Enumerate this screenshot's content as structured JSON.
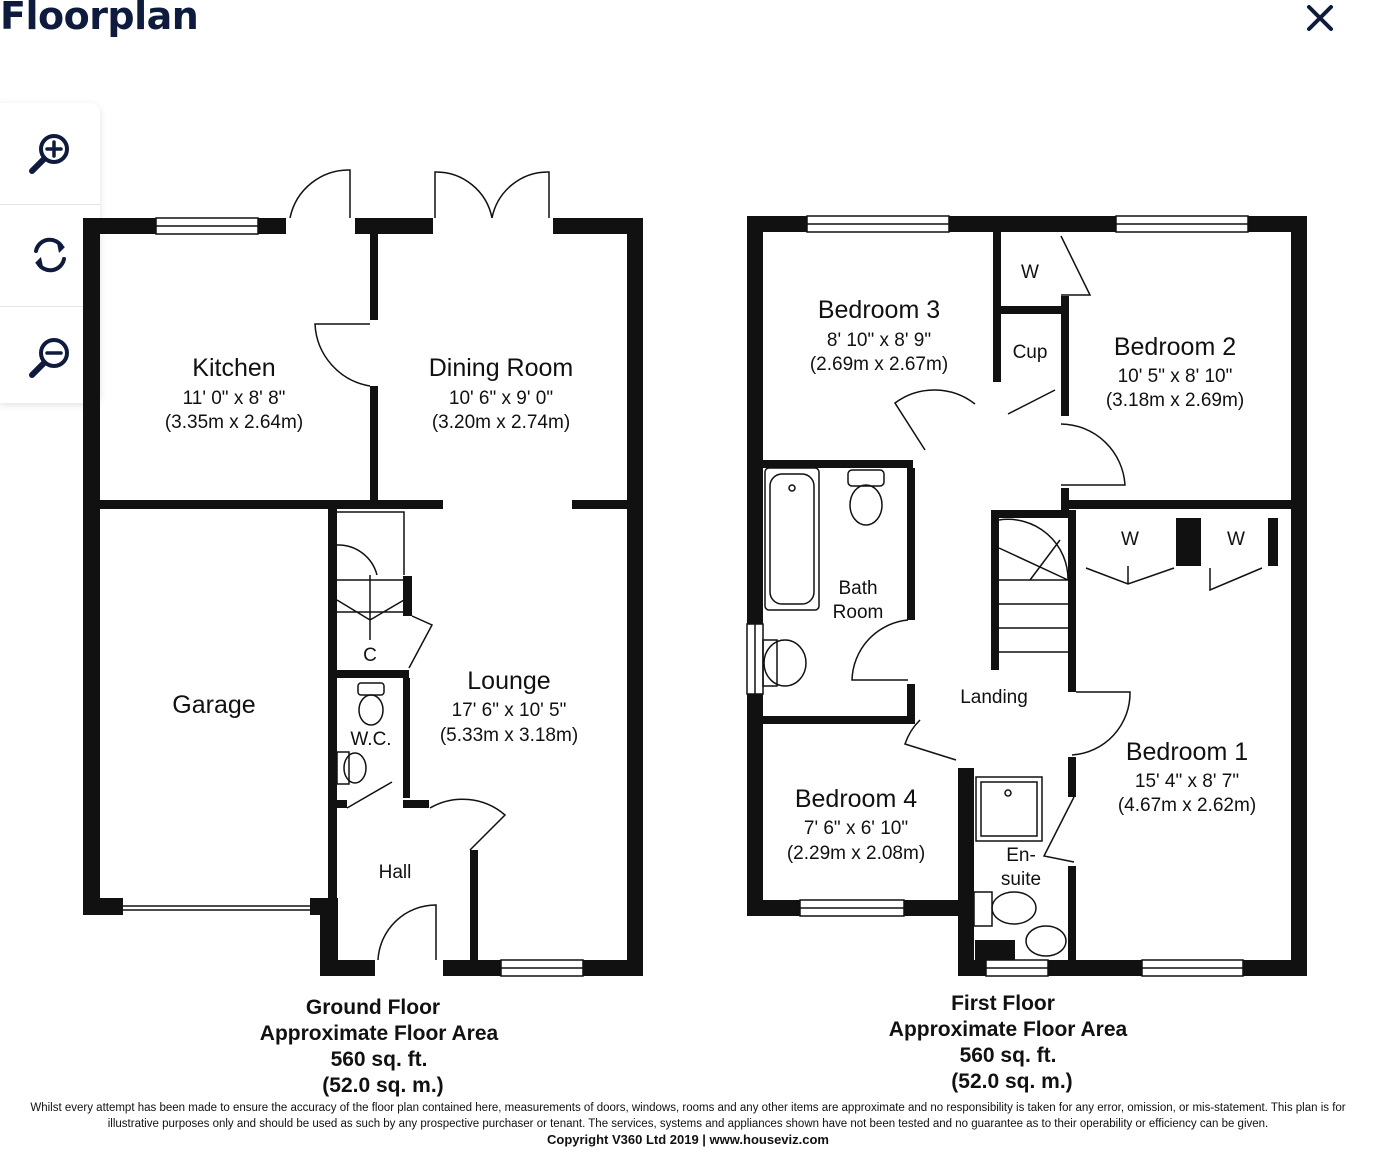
{
  "header": {
    "title": "Floorplan",
    "close_icon": "close-icon"
  },
  "zoom_controls": {
    "zoom_in_icon": "zoom-in-icon",
    "reset_icon": "reset-icon",
    "zoom_out_icon": "zoom-out-icon"
  },
  "colors": {
    "title": "#0f1b3d",
    "walls": "#111111",
    "icons": "#0f1b3d"
  },
  "ground_floor": {
    "rooms": {
      "kitchen": {
        "name": "Kitchen",
        "dim_imperial": "11' 0\" x 8' 8\"",
        "dim_metric": "(3.35m x 2.64m)"
      },
      "dining": {
        "name": "Dining Room",
        "dim_imperial": "10' 6\" x 9' 0\"",
        "dim_metric": "(3.20m x 2.74m)"
      },
      "garage": {
        "name": "Garage"
      },
      "lounge": {
        "name": "Lounge",
        "dim_imperial": "17' 6\" x 10' 5\"",
        "dim_metric": "(5.33m x 3.18m)"
      },
      "cupboard": {
        "name": "C"
      },
      "wc": {
        "name": "W.C."
      },
      "hall": {
        "name": "Hall"
      }
    },
    "label": {
      "line1": "Ground Floor",
      "line2": "Approximate Floor Area",
      "line3": "560 sq. ft.",
      "line4": "(52.0 sq. m.)"
    }
  },
  "first_floor": {
    "rooms": {
      "bedroom3": {
        "name": "Bedroom 3",
        "dim_imperial": "8' 10\" x 8' 9\"",
        "dim_metric": "(2.69m x 2.67m)"
      },
      "bedroom2": {
        "name": "Bedroom 2",
        "dim_imperial": "10' 5\" x 8' 10\"",
        "dim_metric": "(3.18m x 2.69m)"
      },
      "wardrobe_top": {
        "name": "W"
      },
      "cupboard": {
        "name": "Cup"
      },
      "bathroom": {
        "line1": "Bath",
        "line2": "Room"
      },
      "wardrobe_1": {
        "name": "W"
      },
      "wardrobe_2": {
        "name": "W"
      },
      "landing": {
        "name": "Landing"
      },
      "bedroom1": {
        "name": "Bedroom 1",
        "dim_imperial": "15' 4\" x 8' 7\"",
        "dim_metric": "(4.67m x 2.62m)"
      },
      "bedroom4": {
        "name": "Bedroom 4",
        "dim_imperial": "7' 6\" x 6' 10\"",
        "dim_metric": "(2.29m x 2.08m)"
      },
      "ensuite": {
        "line1": "En-",
        "line2": "suite"
      }
    },
    "label": {
      "line1": "First Floor",
      "line2": "Approximate Floor Area",
      "line3": "560 sq. ft.",
      "line4": "(52.0 sq. m.)"
    }
  },
  "footer": {
    "disclaimer_line1": "Whilst every attempt has been made to ensure the accuracy of the floor plan contained here, measurements of doors, windows, rooms and any other items are approximate and no responsibility is taken for any error, omission, or mis-statement. This plan is for",
    "disclaimer_line2": "illustrative purposes only and should be used as such by any prospective purchaser or tenant. The services, systems and appliances shown have not been tested and no guarantee as to their operability or efficiency can be given.",
    "copyright": "Copyright V360 Ltd 2019 | www.houseviz.com"
  }
}
